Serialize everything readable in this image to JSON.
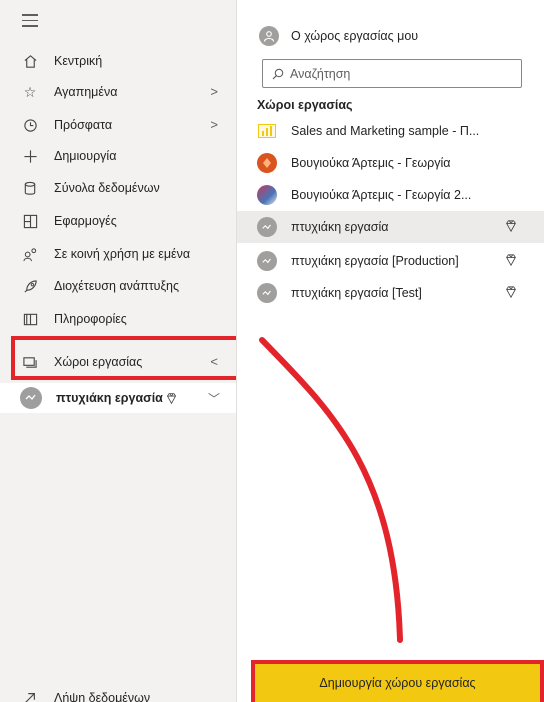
{
  "nav": {
    "items": [
      {
        "label": "Κεντρική",
        "icon": "home-icon"
      },
      {
        "label": "Αγαπημένα",
        "icon": "star-icon",
        "chevron": ">"
      },
      {
        "label": "Πρόσφατα",
        "icon": "clock-icon",
        "chevron": ">"
      },
      {
        "label": "Δημιουργία",
        "icon": "plus-icon"
      },
      {
        "label": "Σύνολα δεδομένων",
        "icon": "database-icon"
      },
      {
        "label": "Εφαρμογές",
        "icon": "apps-icon"
      },
      {
        "label": "Σε κοινή χρήση με εμένα",
        "icon": "shared-icon"
      },
      {
        "label": "Διοχέτευση ανάπτυξης",
        "icon": "rocket-icon"
      },
      {
        "label": "Πληροφορίες",
        "icon": "book-icon"
      },
      {
        "label": "Χώροι εργασίας",
        "icon": "workspaces-icon",
        "chevron": "<"
      },
      {
        "label": "Λήψη δεδομένων",
        "icon": "arrow-up-right-icon"
      }
    ],
    "active_workspace": "πτυχιάκη εργασία"
  },
  "panel": {
    "my_workspace": "Ο χώρος εργασίας μου",
    "search_placeholder": "Αναζήτηση",
    "section_title": "Χώροι εργασίας",
    "workspaces": [
      {
        "name": "Sales and Marketing sample - Π...",
        "thumb": "chart-icon"
      },
      {
        "name": "Βουγιούκα Άρτεμις - Γεωργία",
        "thumb": "orange-logo"
      },
      {
        "name": "Βουγιούκα Άρτεμις - Γεωργία 2...",
        "thumb": "photo-thumb"
      },
      {
        "name": "πτυχιάκη εργασία",
        "thumb": "gray-avatar",
        "premium": true,
        "selected": true
      },
      {
        "name": "πτυχιάκη εργασία [Production]",
        "thumb": "gray-avatar",
        "premium": true
      },
      {
        "name": "πτυχιάκη εργασία [Test]",
        "thumb": "gray-avatar",
        "premium": true
      }
    ],
    "create_button": "Δημιουργία χώρου εργασίας"
  },
  "colors": {
    "accent_yellow": "#f2c811",
    "annotation_red": "#e3242b",
    "nav_bg": "#f3f2f1"
  }
}
